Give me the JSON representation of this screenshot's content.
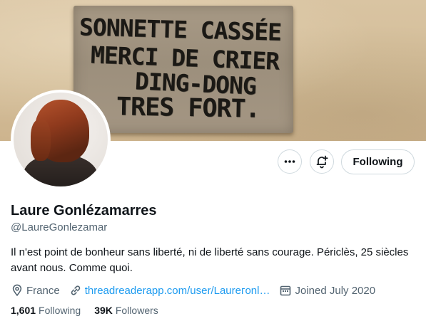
{
  "banner": {
    "sign_lines": [
      "SONNETTE CASSÉE",
      "MERCI DE CRIER",
      "DING-DONG",
      "TRES FORT."
    ]
  },
  "profile": {
    "display_name": "Laure Gonlézamarres",
    "handle": "@LaureGonlezamar",
    "bio": "Il n'est point de bonheur sans liberté, ni de liberté sans courage. Périclès, 25 siècles avant nous. Comme quoi.",
    "location": "France",
    "website": "threadreaderapp.com/user/Laurегonl…",
    "joined": "Joined July 2020"
  },
  "actions": {
    "more_icon": "ellipsis-icon",
    "notify_icon": "bell-plus-icon",
    "follow_label": "Following"
  },
  "stats": {
    "following_count": "1,601",
    "following_label": "Following",
    "followers_count": "39K",
    "followers_label": "Followers"
  },
  "colors": {
    "accent": "#1d9bf0",
    "secondary_text": "#536471",
    "border": "#cfd9de"
  }
}
